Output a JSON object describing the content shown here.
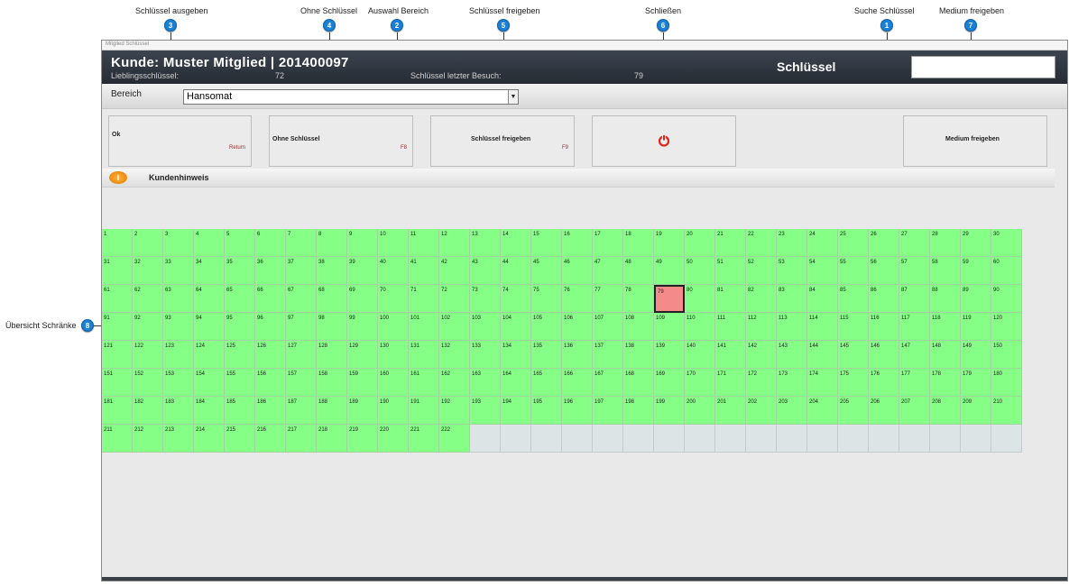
{
  "annotations": [
    {
      "num": "1",
      "label": "Suche Schlüssel"
    },
    {
      "num": "2",
      "label": "Auswahl Bereich"
    },
    {
      "num": "3",
      "label": "Schlüssel ausgeben"
    },
    {
      "num": "4",
      "label": "Ohne Schlüssel"
    },
    {
      "num": "5",
      "label": "Schlüssel freigeben"
    },
    {
      "num": "6",
      "label": "Schließen"
    },
    {
      "num": "7",
      "label": "Medium freigeben"
    },
    {
      "num": "8",
      "label": "Übersicht Schränke"
    }
  ],
  "window": {
    "title": "Mitglied Schlüssel"
  },
  "header": {
    "customer": "Kunde: Muster Mitglied | 201400097",
    "favorite_label": "Lieblingsschlüssel:",
    "favorite_value": "72",
    "last_visit_label": "Schlüssel letzter Besuch:",
    "last_visit_value": "79",
    "section_title": "Schlüssel",
    "search_value": ""
  },
  "bereich": {
    "label": "Bereich",
    "selected": "Hansomat"
  },
  "buttons": {
    "ok": {
      "label": "Ok",
      "key": "Return"
    },
    "ohne": {
      "label": "Ohne Schlüssel",
      "key": "F8"
    },
    "freigeben": {
      "label": "Schlüssel freigeben",
      "key": "F9"
    },
    "schliessen": {
      "icon": "power-icon"
    },
    "medium": {
      "label": "Medium freigeben"
    }
  },
  "hint": {
    "label": "Kundenhinweis",
    "icon": "info-icon"
  },
  "lockers": {
    "total": 222,
    "occupied": [
      79
    ],
    "colors": {
      "free": "#85ff85",
      "occupied": "#f58a8a",
      "empty": "#dde4e6",
      "accent": "#1a7fd6"
    }
  }
}
